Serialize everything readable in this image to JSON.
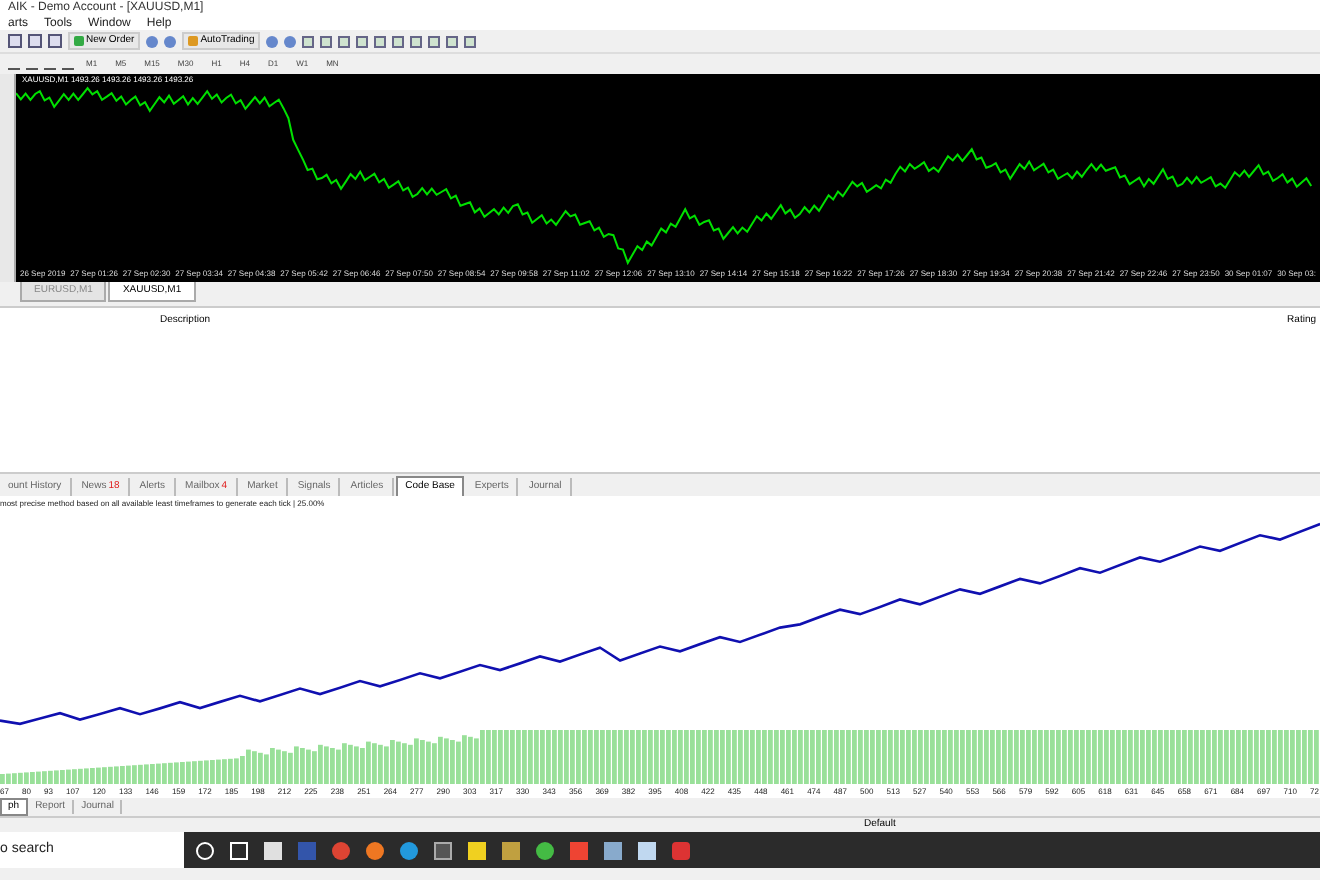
{
  "window": {
    "title": "AIK - Demo Account - [XAUUSD,M1]"
  },
  "menu": [
    "arts",
    "Tools",
    "Window",
    "Help"
  ],
  "toolbar": [
    {
      "kind": "text",
      "label": "New Order"
    },
    {
      "kind": "text",
      "label": "AutoTrading"
    }
  ],
  "timeframes": [
    "M1",
    "M5",
    "M15",
    "M30",
    "H1",
    "H4",
    "D1",
    "W1",
    "MN"
  ],
  "chart": {
    "legend": "XAUUSD,M1  1493.26 1493.26 1493.26 1493.26",
    "time_labels": [
      "26 Sep 2019",
      "27 Sep 01:26",
      "27 Sep 02:30",
      "27 Sep 03:34",
      "27 Sep 04:38",
      "27 Sep 05:42",
      "27 Sep 06:46",
      "27 Sep 07:50",
      "27 Sep 08:54",
      "27 Sep 09:58",
      "27 Sep 11:02",
      "27 Sep 12:06",
      "27 Sep 13:10",
      "27 Sep 14:14",
      "27 Sep 15:18",
      "27 Sep 16:22",
      "27 Sep 17:26",
      "27 Sep 18:30",
      "27 Sep 19:34",
      "27 Sep 20:38",
      "27 Sep 21:42",
      "27 Sep 22:46",
      "27 Sep 23:50",
      "30 Sep 01:07",
      "30 Sep 03:"
    ]
  },
  "chart_tabs": [
    {
      "label": "EURUSD,M1",
      "selected": false
    },
    {
      "label": "XAUUSD,M1",
      "selected": true
    }
  ],
  "columns": [
    "Description",
    "Rating"
  ],
  "terminal_tabs": [
    {
      "label": "ount History",
      "selected": false
    },
    {
      "label": "News",
      "badge": "18",
      "selected": false
    },
    {
      "label": "Alerts",
      "selected": false
    },
    {
      "label": "Mailbox",
      "badge": "4",
      "selected": false
    },
    {
      "label": "Market",
      "selected": false
    },
    {
      "label": "Signals",
      "selected": false
    },
    {
      "label": "Articles",
      "selected": false
    },
    {
      "label": "Code Base",
      "selected": true
    },
    {
      "label": "Experts",
      "selected": false
    },
    {
      "label": "Journal",
      "selected": false
    }
  ],
  "tester": {
    "status": "most precise method based on all available least timeframes to generate each tick | 25.00%",
    "x_labels": [
      "67",
      "80",
      "93",
      "107",
      "120",
      "133",
      "146",
      "159",
      "172",
      "185",
      "198",
      "212",
      "225",
      "238",
      "251",
      "264",
      "277",
      "290",
      "303",
      "317",
      "330",
      "343",
      "356",
      "369",
      "382",
      "395",
      "408",
      "422",
      "435",
      "448",
      "461",
      "474",
      "487",
      "500",
      "513",
      "527",
      "540",
      "553",
      "566",
      "579",
      "592",
      "605",
      "618",
      "631",
      "645",
      "658",
      "671",
      "684",
      "697",
      "710",
      "72"
    ]
  },
  "tester_tabs": [
    {
      "label": "ph",
      "selected": true
    },
    {
      "label": "Report",
      "selected": false
    },
    {
      "label": "Journal",
      "selected": false
    }
  ],
  "status_bar": {
    "profile": "Default"
  },
  "taskbar": {
    "search": "o search"
  }
}
